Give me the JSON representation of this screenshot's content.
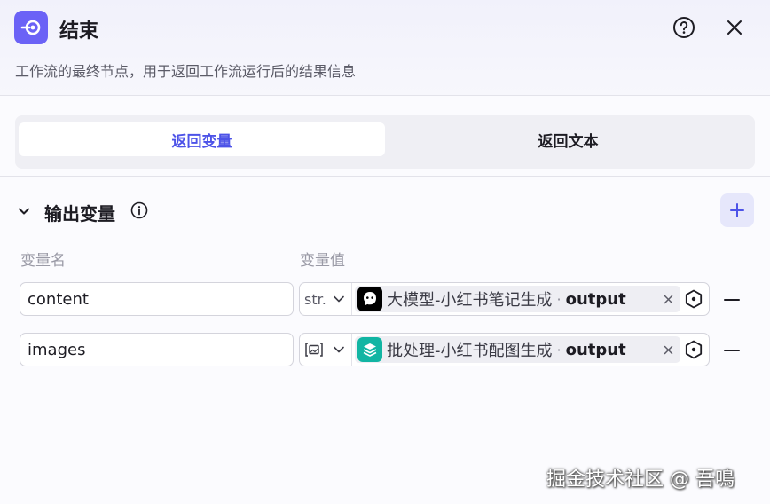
{
  "header": {
    "title": "结束",
    "description": "工作流的最终节点，用于返回工作流运行后的结果信息",
    "accent_color": "#6b62f6",
    "icons": {
      "app": "end-node-icon",
      "help": "help-circle-icon",
      "close": "close-icon"
    }
  },
  "tabs": [
    {
      "label": "返回变量",
      "active": true
    },
    {
      "label": "返回文本",
      "active": false
    }
  ],
  "output_section": {
    "title": "输出变量",
    "columns": {
      "name": "变量名",
      "value": "变量值"
    },
    "rows": [
      {
        "name": "content",
        "type_label": "str.",
        "node_icon": "llm-node-icon",
        "node_icon_color": "#000000",
        "ref_node": "大模型-小红书笔记生成",
        "ref_sep": "·",
        "ref_var": "output"
      },
      {
        "name": "images",
        "type_label": "",
        "type_icon": "image-array-icon",
        "node_icon": "batch-node-icon",
        "node_icon_color": "#12b5a3",
        "ref_node": "批处理-小红书配图生成",
        "ref_sep": "·",
        "ref_var": "output"
      }
    ]
  },
  "watermark": "掘金技术社区 @ 吾鳴"
}
